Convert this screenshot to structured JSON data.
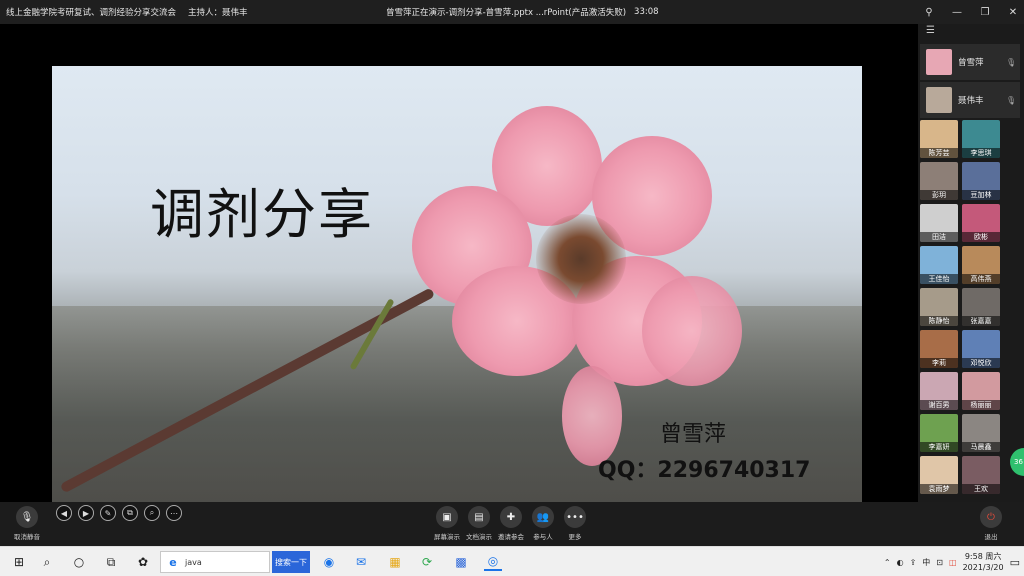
{
  "titlebar": {
    "meeting_title": "线上金融学院考研复试、调剂经验分享交流会",
    "host": "主持人：聂伟丰",
    "presenting": "曾雪萍正在演示-调剂分享-曾雪萍.pptx ...rPoint(产品激活失败)",
    "timer": "33:08",
    "controls": {
      "pin": "⚲",
      "minimize": "—",
      "restore": "❐",
      "close": "✕"
    }
  },
  "slide": {
    "title": "调剂分享",
    "author": "曾雪萍",
    "qq": "QQ：2296740317",
    "tools": [
      "◀",
      "▶",
      "✎",
      "⧉",
      "⌕",
      "⋯"
    ]
  },
  "panel": {
    "menu_icon": "☰",
    "video_cards": [
      {
        "name": "曾雪萍",
        "color": "#e7a7b4"
      },
      {
        "name": "聂伟丰",
        "color": "#b8a99a"
      }
    ],
    "tiles": [
      {
        "name": "陈芳芸",
        "color": "#d8b68a"
      },
      {
        "name": "李思琪",
        "color": "#3d8a91"
      },
      {
        "name": "彭玥",
        "color": "#8d7f77"
      },
      {
        "name": "豆加林",
        "color": "#5a6f9a"
      },
      {
        "name": "田洁",
        "color": "#cfcfcf"
      },
      {
        "name": "欧彬",
        "color": "#c4597a"
      },
      {
        "name": "王佳怡",
        "color": "#7fb2d9"
      },
      {
        "name": "高伟燕",
        "color": "#b88a5b"
      },
      {
        "name": "陈静怡",
        "color": "#a69b8a"
      },
      {
        "name": "张嘉嘉",
        "color": "#6f6a66"
      },
      {
        "name": "李莉",
        "color": "#a86d48"
      },
      {
        "name": "邓悦欣",
        "color": "#5f80b6"
      },
      {
        "name": "谢百男",
        "color": "#cba7b3"
      },
      {
        "name": "杨丽丽",
        "color": "#d29a9f"
      },
      {
        "name": "李嘉妍",
        "color": "#6ea150"
      },
      {
        "name": "马晨鑫",
        "color": "#8b8682"
      },
      {
        "name": "袁雨梦",
        "color": "#e0c6a8"
      },
      {
        "name": "王欢",
        "color": "#7a5c62"
      }
    ],
    "badge": "36"
  },
  "controls": {
    "mute": {
      "icon": "🎙",
      "label": "取消静音"
    },
    "screen_share": {
      "icon": "▣",
      "label": "屏幕演示"
    },
    "doc_share": {
      "icon": "▤",
      "label": "文档演示"
    },
    "invite": {
      "icon": "✚",
      "label": "邀请参会"
    },
    "participants": {
      "icon": "👥",
      "label": "参与人"
    },
    "more": {
      "icon": "•••",
      "label": "更多"
    },
    "leave": {
      "icon": "⏻",
      "label": "退出"
    }
  },
  "taskbar": {
    "start_icon": "⊞",
    "search_icon": "⌕",
    "cortana_icon": "○",
    "task_view_icon": "⧉",
    "search_value": "java",
    "search_button": "搜索一下",
    "apps": [
      "◉",
      "✉",
      "▦",
      "⟳",
      "▩",
      "◎"
    ],
    "tray_icons": [
      "⌃",
      "◐",
      "⇪",
      "中",
      "⊡",
      "◫"
    ],
    "time": "9:58 周六",
    "date": "2021/3/20",
    "notification_icon": "▭"
  },
  "colors": {
    "accent": "#2b66d9",
    "leave": "#e24b3b",
    "badge": "#2fc06e"
  }
}
